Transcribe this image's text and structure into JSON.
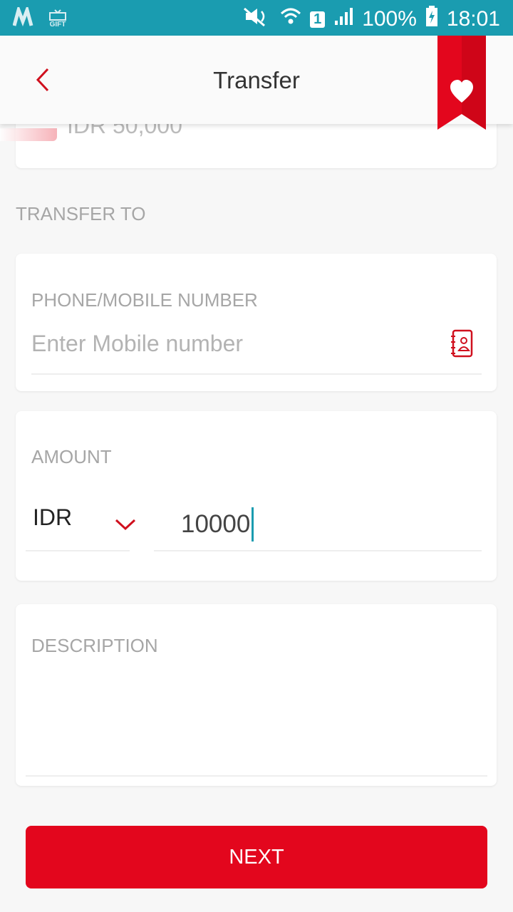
{
  "status_bar": {
    "battery": "100%",
    "time": "18:01",
    "sim_slot": "1",
    "left_icon_text": "GIFT"
  },
  "header": {
    "title": "Transfer"
  },
  "top_card": {
    "text": "IDR 50,000"
  },
  "transfer_to": {
    "section_label": "TRANSFER TO",
    "phone_label": "PHONE/MOBILE NUMBER",
    "phone_placeholder": "Enter Mobile number"
  },
  "amount": {
    "label": "AMOUNT",
    "currency": "IDR",
    "value": "10000"
  },
  "description": {
    "label": "DESCRIPTION"
  },
  "actions": {
    "next_label": "NEXT"
  },
  "colors": {
    "status_bar": "#1a9cb0",
    "accent": "#e3061d"
  }
}
